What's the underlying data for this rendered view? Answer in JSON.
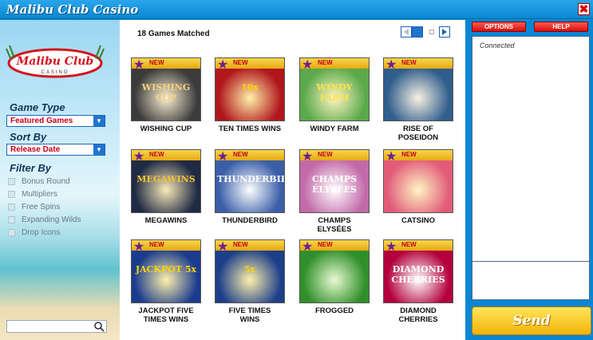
{
  "window": {
    "title": "Malibu Club Casino",
    "close_glyph": "✖"
  },
  "sidebar": {
    "logo": {
      "line1": "Malibu Club",
      "line2": "CASINO"
    },
    "game_type_label": "Game Type",
    "game_type_value": "Featured Games",
    "sort_by_label": "Sort By",
    "sort_by_value": "Release Date",
    "filter_by_label": "Filter By",
    "filters": [
      "Bonus Round",
      "Multipliers",
      "Free Spins",
      "Expanding Wilds",
      "Drop Icons"
    ],
    "search_placeholder": ""
  },
  "main": {
    "matched_text": "18 Games Matched",
    "badge_text": "NEW",
    "games": [
      {
        "name_line1": "WISHING CUP",
        "name_line2": "",
        "art_text": "WISHING CUP",
        "bg": "#3b3b3b",
        "fg": "#f4d27a"
      },
      {
        "name_line1": "TEN TIMES WINS",
        "name_line2": "",
        "art_text": "10x",
        "bg": "#b0161c",
        "fg": "#ffd400"
      },
      {
        "name_line1": "WINDY FARM",
        "name_line2": "",
        "art_text": "WINDY FARM",
        "bg": "#5aa94a",
        "fg": "#ffe14a"
      },
      {
        "name_line1": "RISE OF",
        "name_line2": "POSEIDON",
        "art_text": "",
        "bg": "#2f5d8c",
        "fg": "#e8d6a8"
      },
      {
        "name_line1": "MEGAWINS",
        "name_line2": "",
        "art_text": "MEGAWINS",
        "bg": "#1f2a44",
        "fg": "#f2c230"
      },
      {
        "name_line1": "THUNDERBIRD",
        "name_line2": "",
        "art_text": "THUNDERBIRD",
        "bg": "#3a5ea8",
        "fg": "#ffffff"
      },
      {
        "name_line1": "CHAMPS",
        "name_line2": "ELYSÉES",
        "art_text": "CHAMPS ÉLYSÉES",
        "bg": "#c26aa8",
        "fg": "#ffffff"
      },
      {
        "name_line1": "CATSINO",
        "name_line2": "",
        "art_text": "",
        "bg": "#e25c7a",
        "fg": "#ffe14a"
      },
      {
        "name_line1": "JACKPOT FIVE",
        "name_line2": "TIMES WINS",
        "art_text": "JACKPOT 5x",
        "bg": "#1b3c8e",
        "fg": "#ffd400"
      },
      {
        "name_line1": "FIVE TIMES",
        "name_line2": "WINS",
        "art_text": "5x",
        "bg": "#1d3f8a",
        "fg": "#ffd400"
      },
      {
        "name_line1": "FROGGED",
        "name_line2": "",
        "art_text": "",
        "bg": "#2f8f2a",
        "fg": "#bff07a"
      },
      {
        "name_line1": "DIAMOND",
        "name_line2": "CHERRIES",
        "art_text": "DIAMOND CHERRIES",
        "bg": "#b3003c",
        "fg": "#ffffff"
      }
    ]
  },
  "right_panel": {
    "options_label": "OPTIONS",
    "help_label": "HELP",
    "status_text": "Connected",
    "send_label": "Send"
  },
  "colors": {
    "titlebar": "#0b86cf",
    "accent_red": "#d40f0f",
    "send_yellow": "#f2b30a"
  }
}
